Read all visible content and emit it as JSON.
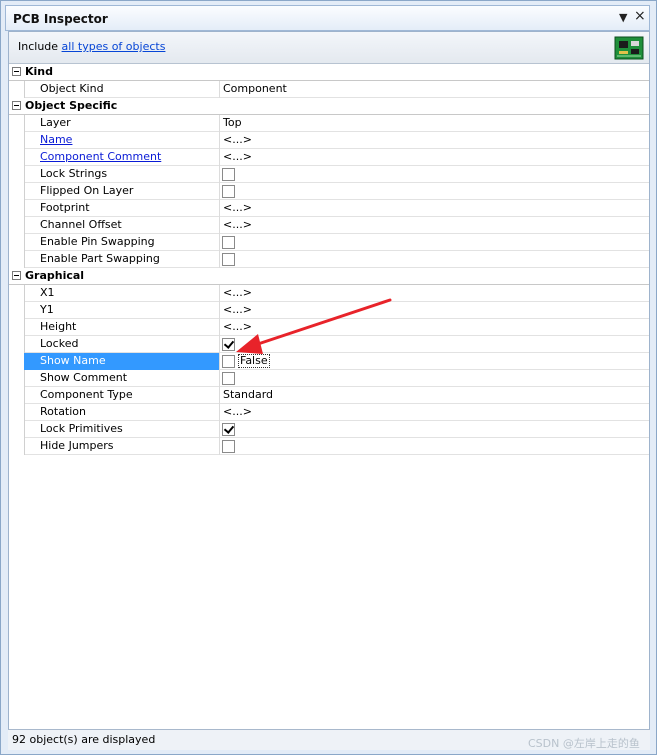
{
  "window": {
    "title": "PCB Inspector",
    "dropdown_glyph": "▼",
    "close_glyph": "×"
  },
  "filter": {
    "prefix": "Include",
    "link": "all types of objects"
  },
  "categories": {
    "kind": {
      "label": "Kind"
    },
    "object_specific": {
      "label": "Object Specific"
    },
    "graphical": {
      "label": "Graphical"
    }
  },
  "rows": {
    "object_kind": {
      "name": "Object Kind",
      "value": "Component"
    },
    "layer": {
      "name": "Layer",
      "value": "Top"
    },
    "name": {
      "name": "Name",
      "value": "<...>"
    },
    "component_comment": {
      "name": "Component Comment",
      "value": "<...>"
    },
    "lock_strings": {
      "name": "Lock Strings",
      "checked": false
    },
    "flipped_on_layer": {
      "name": "Flipped On Layer",
      "checked": false
    },
    "footprint": {
      "name": "Footprint",
      "value": "<...>"
    },
    "channel_offset": {
      "name": "Channel Offset",
      "value": "<...>"
    },
    "enable_pin_swapping": {
      "name": "Enable Pin Swapping",
      "checked": false
    },
    "enable_part_swapping": {
      "name": "Enable Part Swapping",
      "checked": false
    },
    "x1": {
      "name": "X1",
      "value": "<...>"
    },
    "y1": {
      "name": "Y1",
      "value": "<...>"
    },
    "height": {
      "name": "Height",
      "value": "<...>"
    },
    "locked": {
      "name": "Locked",
      "checked": true
    },
    "show_name": {
      "name": "Show Name",
      "checked": false,
      "value_text": "False"
    },
    "show_comment": {
      "name": "Show Comment",
      "checked": false
    },
    "component_type": {
      "name": "Component Type",
      "value": "Standard"
    },
    "rotation": {
      "name": "Rotation",
      "value": "<...>"
    },
    "lock_primitives": {
      "name": "Lock Primitives",
      "checked": true
    },
    "hide_jumpers": {
      "name": "Hide Jumpers",
      "checked": false
    }
  },
  "status": {
    "text": "92 object(s) are displayed"
  },
  "watermark": "CSDN @左岸上走的鱼",
  "colors": {
    "selection": "#3399ff",
    "link": "#0645d6",
    "annotation_arrow": "#e8232a"
  },
  "icons": {
    "board": "pcb-board-icon",
    "annotation": "red-arrow"
  }
}
